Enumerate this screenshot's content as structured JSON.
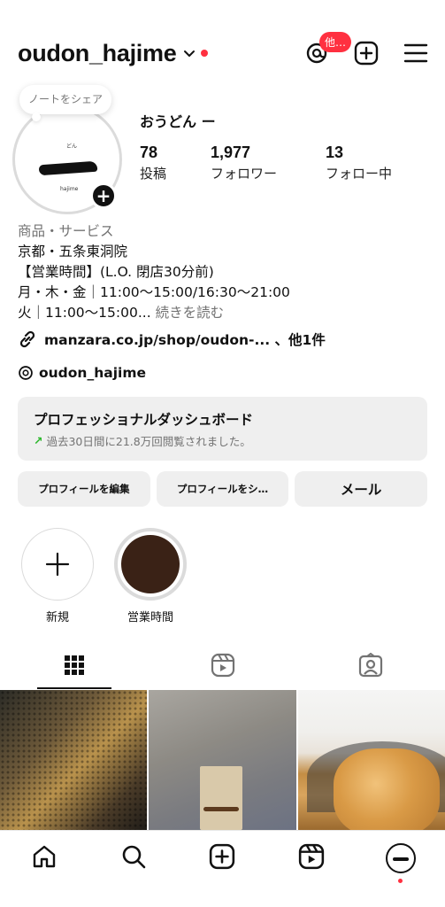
{
  "header": {
    "username": "oudon_hajime",
    "threads_badge": "他…"
  },
  "profile": {
    "note": "ノートをシェア",
    "avatar_small_text": "どん",
    "avatar_brand": "hajime",
    "display_name": "おうどん ー",
    "stats": [
      {
        "num": "78",
        "label": "投稿"
      },
      {
        "num": "1,977",
        "label": "フォロワー"
      },
      {
        "num": "13",
        "label": "フォロー中"
      }
    ]
  },
  "bio": {
    "category": "商品・サービス",
    "lines": [
      "京都・五条東洞院",
      "【営業時間】(L.O. 閉店30分前)",
      "月・木・金｜11:00～15:00/16:30～21:00",
      "火｜11:00～15:00..."
    ],
    "more": "続きを読む",
    "link": "manzara.co.jp/shop/oudon-... 、他1件",
    "threads_handle": "oudon_hajime"
  },
  "dashboard": {
    "title": "プロフェッショナルダッシュボード",
    "subtitle": "過去30日間に21.8万回閲覧されました。",
    "accent": "#2eb82e"
  },
  "buttons": {
    "edit": "プロフィールを編集",
    "share": "プロフィールをシ…",
    "email": "メール"
  },
  "highlights": [
    {
      "label": "新規"
    },
    {
      "label": "営業時間"
    }
  ],
  "colors": {
    "badge": "#ff3040",
    "button_bg": "#efefef",
    "muted_text": "#737373"
  },
  "icons": {
    "header": [
      "chevron-down-icon",
      "threads-icon",
      "create-icon",
      "menu-icon"
    ],
    "tabs": [
      "grid-icon",
      "reels-icon",
      "tagged-icon"
    ],
    "bottom_nav": [
      "home-icon",
      "search-icon",
      "create-icon",
      "reels-icon",
      "profile-icon"
    ]
  }
}
